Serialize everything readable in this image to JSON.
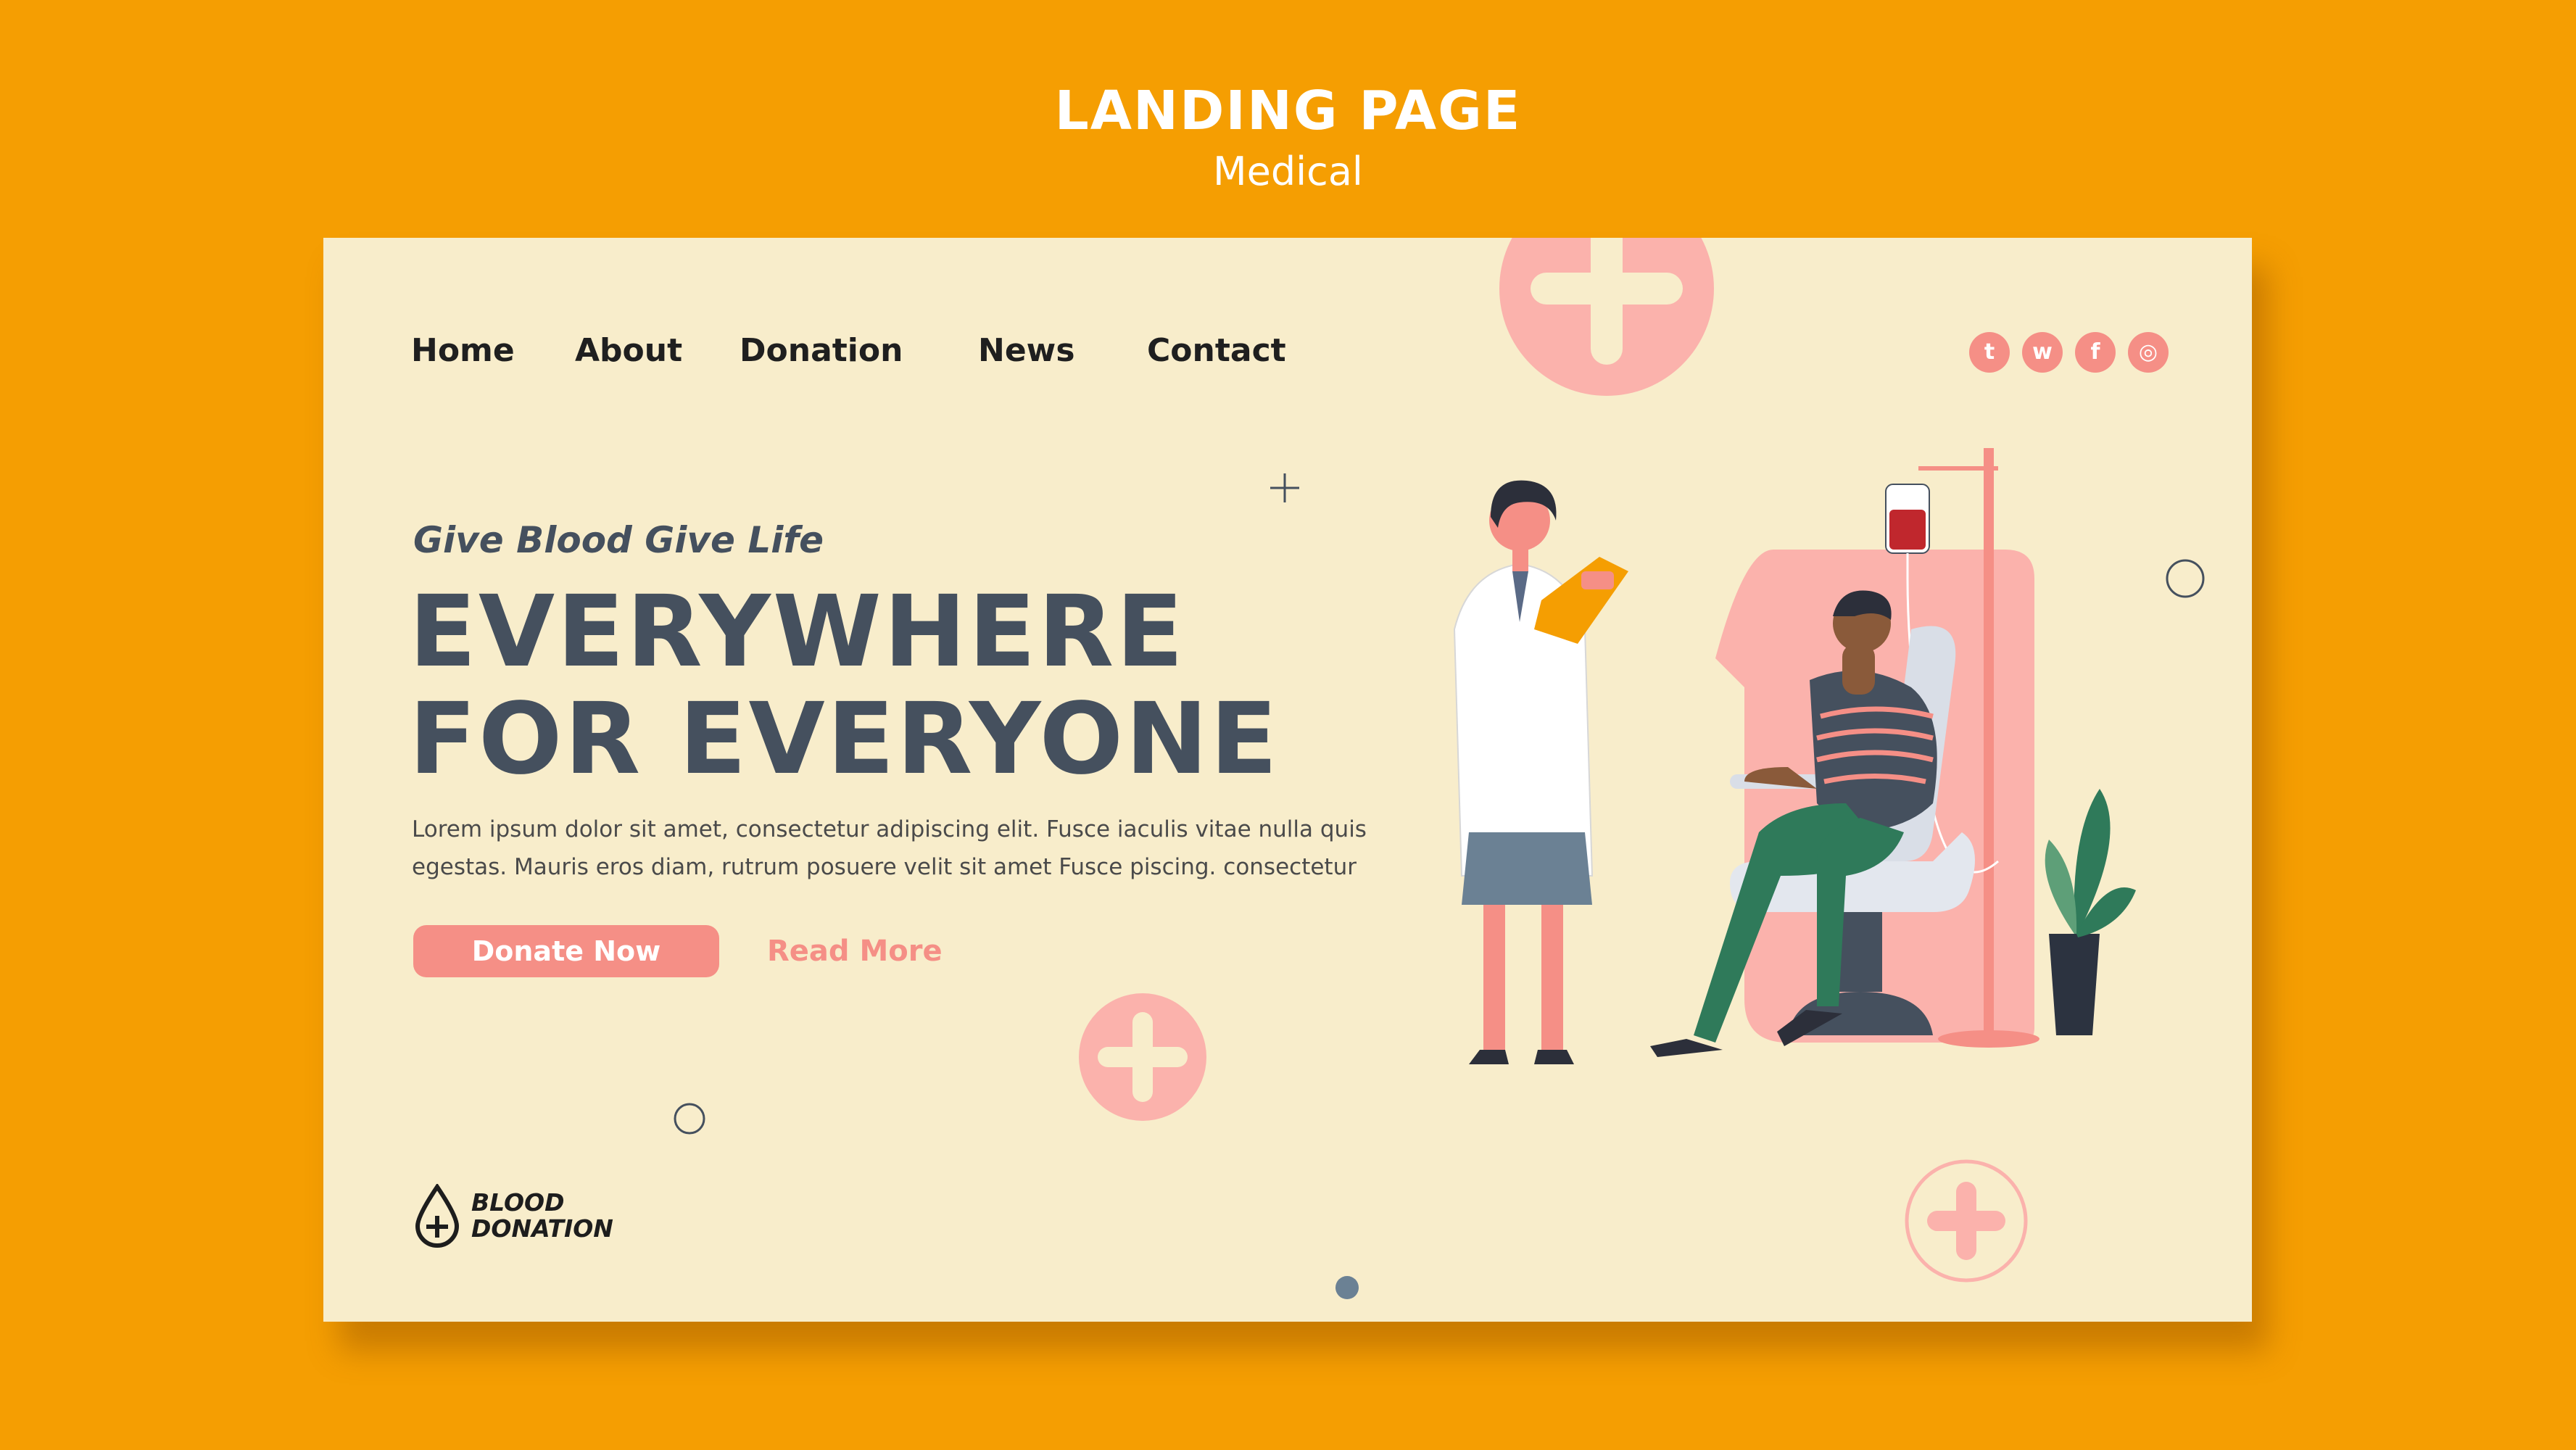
{
  "poster": {
    "title": "LANDING PAGE",
    "subtitle": "Medical"
  },
  "nav": {
    "items": [
      "Home",
      "About",
      "Donation",
      "News",
      "Contact"
    ]
  },
  "social": [
    {
      "icon": "twitter-icon",
      "glyph": "t"
    },
    {
      "icon": "whatsapp-icon",
      "glyph": "w"
    },
    {
      "icon": "facebook-icon",
      "glyph": "f"
    },
    {
      "icon": "instagram-icon",
      "glyph": "◎"
    }
  ],
  "hero": {
    "tagline": "Give Blood Give Life",
    "headline_line1": "EVERYWHERE",
    "headline_line2": "FOR EVERYONE",
    "body_line1": "Lorem ipsum dolor sit amet, consectetur adipiscing elit. Fusce iaculis vitae nulla quis",
    "body_line2": "egestas. Mauris eros diam, rutrum posuere velit sit amet Fusce piscing. consectetur"
  },
  "actions": {
    "primary": "Donate Now",
    "secondary": "Read More"
  },
  "logo": {
    "line1": "BLOOD",
    "line2": "DONATION"
  },
  "colors": {
    "background": "#F59E02",
    "card": "#F8EDCB",
    "accent": "#F58F86",
    "text_dark": "#45505E"
  }
}
